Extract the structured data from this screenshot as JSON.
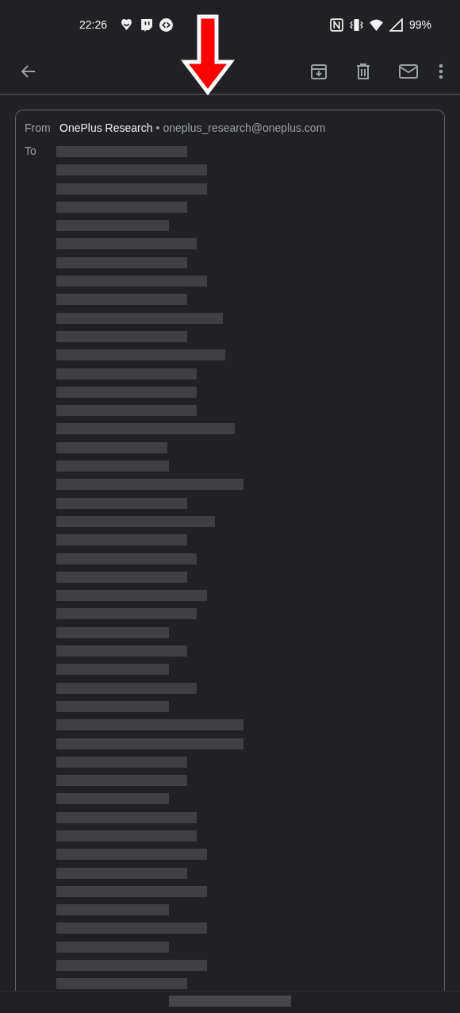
{
  "status_bar": {
    "time": "22:26",
    "battery": "99%"
  },
  "message": {
    "from_label": "From",
    "sender_name": "OnePlus Research",
    "separator": "•",
    "sender_email": "oneplus_research@oneplus.com",
    "to_label": "To"
  }
}
